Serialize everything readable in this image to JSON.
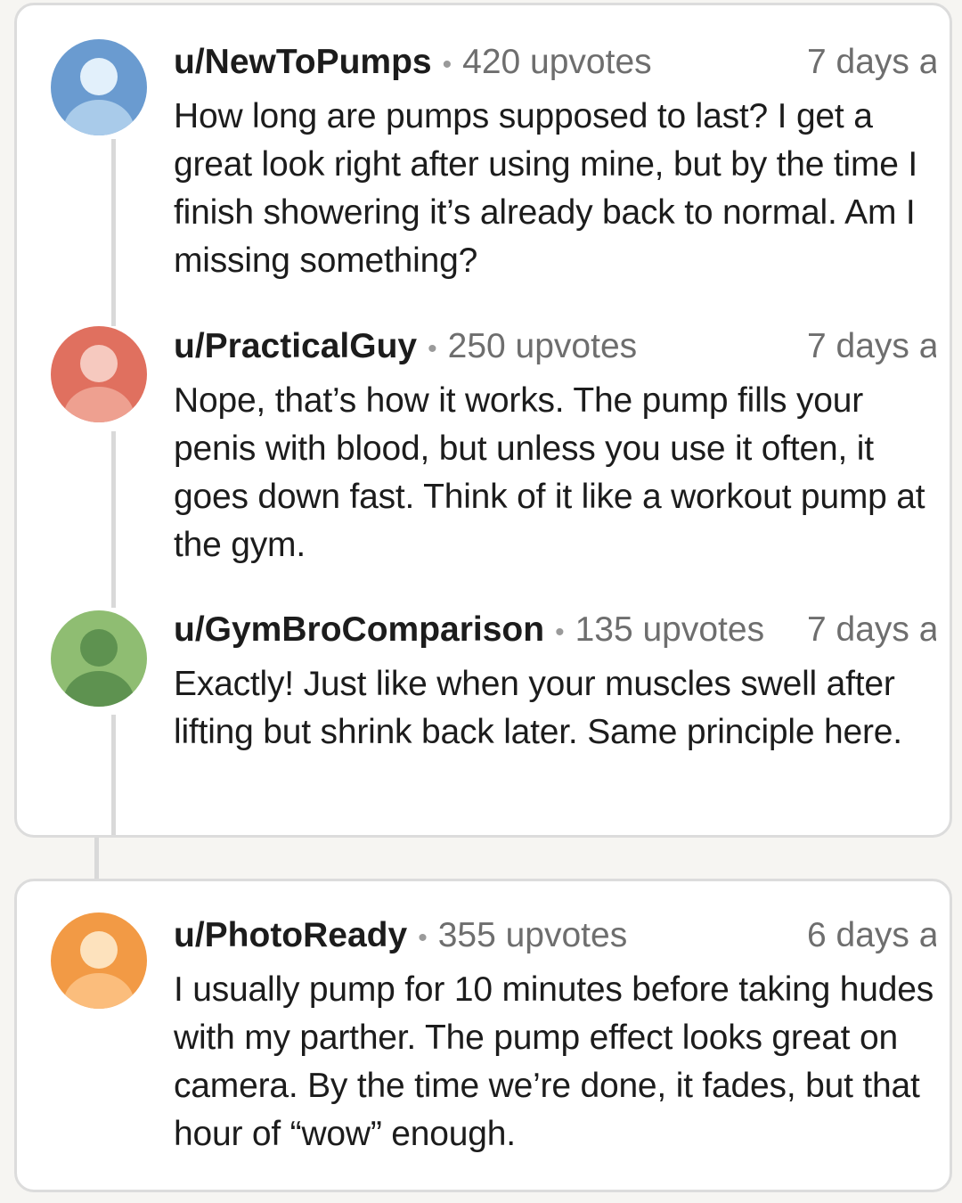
{
  "comments": [
    {
      "username": "u/NewToPumps",
      "upvotes": "420 upvotes",
      "time": "7 days a",
      "body": "How long are pumps supposed to last? I get a great look right after using mine, but by the time I finish showering it’s already back to normal. Am I missing something?",
      "avatar_color": "#6a9bd0",
      "avatar_head_color": "#e2f0fb",
      "avatar_body_color": "#a9cbea"
    },
    {
      "username": "u/PracticalGuy",
      "upvotes": "250 upvotes",
      "time": "7 days a",
      "body": "Nope, that’s how it works. The pump fills your penis with blood, but unless you use it often, it goes down fast. Think of it like a workout pump at the gym.",
      "avatar_color": "#e0705f",
      "avatar_head_color": "#f6c9bf",
      "avatar_body_color": "#eea090"
    },
    {
      "username": "u/GymBroComparison",
      "upvotes": "135 upvotes",
      "time": "7 days a",
      "body": "Exactly! Just like when your muscles swell after lifting but shrink back later. Same principle here.",
      "avatar_color": "#8fbd72",
      "avatar_head_color": "#5e9250",
      "avatar_body_color": "#5e9250"
    },
    {
      "username": "u/PhotoReady",
      "upvotes": "355 upvotes",
      "time": "6 days a",
      "body": "I usually pump for 10 minutes before taking hudes with my parther. The pump effect looks great on camera. By the time we’re done, it fades, but that hour of “wow” enough.",
      "avatar_color": "#f29a45",
      "avatar_head_color": "#fde2bd",
      "avatar_body_color": "#fbbd7c"
    }
  ],
  "separator": "•"
}
